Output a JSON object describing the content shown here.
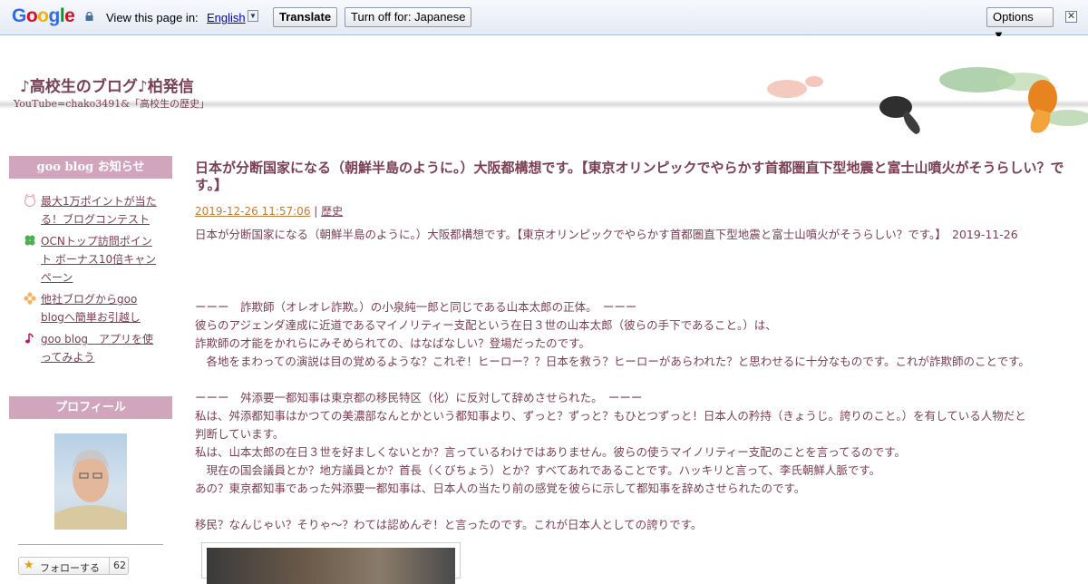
{
  "translate_bar": {
    "logo_letters": [
      "G",
      "o",
      "o",
      "g",
      "l",
      "e"
    ],
    "view_text": "View this page in:",
    "language": "English",
    "translate_button": "Translate",
    "turn_off_button": "Turn off for: Japanese",
    "options_button": "Options ▼",
    "close": "✕"
  },
  "blog": {
    "title": "♪高校生のブログ♪柏発信",
    "subtitle": "YouTube=chako3491&「高校生の歴史」"
  },
  "sidebar": {
    "notice_heading": "goo blog お知らせ",
    "notices": [
      {
        "label": "最大1万ポイントが当たる！ブログコンテスト",
        "icon": "cat-icon"
      },
      {
        "label": "OCNトップ訪問ポイント ボーナス10倍キャンペーン",
        "icon": "clover-icon"
      },
      {
        "label": "他社ブログからgoo blogへ簡単お引越し",
        "icon": "flower-icon"
      },
      {
        "label": "goo blog　アプリを使ってみよう",
        "icon": "music-note-icon"
      }
    ],
    "profile_heading": "プロフィール",
    "follow_label": "フォローする",
    "follow_count": "62"
  },
  "post": {
    "title": "日本が分断国家になる（朝鮮半島のように。）大阪都構想です。【東京オリンピックでやらかす首都圏直下型地震と富士山噴火がそうらしい？です。】",
    "date": "2019-12-26 11:57:06",
    "separator": "|",
    "category": "歴史",
    "lines": [
      "日本が分断国家になる（朝鮮半島のように。）大阪都構想です。【東京オリンピックでやらかす首都圏直下型地震と富士山噴火がそうらしい？です。】　2019-11-26",
      "",
      "",
      "",
      "ーーー　詐欺師（オレオレ詐欺。）の小泉純一郎と同じである山本太郎の正体。　ーーー",
      "彼らのアジェンダ達成に近道であるマイノリティー支配という在日３世の山本太郎（彼らの手下であること。）は、",
      "詐欺師の才能をかれらにみそめられての、はなばなしい？登場だったのです。",
      "　各地をまわっての演説は目の覚めるような？これぞ！ヒーロー？？日本を救う？ヒーローがあらわれた？と思わせるに十分なものです。これが詐欺師のことです。",
      "",
      "ーーー　舛添要一都知事は東京都の移民特区（化）に反対して辞めさせられた。　ーーー",
      "私は、舛添都知事はかつての美濃部なんとかという都知事より、ずっと？ずっと？もひとつずっと！日本人の矜持（きょうじ。誇りのこと。）を有している人物だと",
      "判断しています。",
      "私は、山本太郎の在日３世を好ましくないとか？言っているわけではありません。彼らの使うマイノリティー支配のことを言ってるのです。",
      "　現在の国会議員とか？地方議員とか？首長（くびちょう）とか？すべてあれであることです。ハッキリと言って、李氏朝鮮人脈です。",
      "あの？東京都知事であった舛添要一都知事は、日本人の当たり前の感覚を彼らに示して都知事を辞めさせられたのです。",
      "",
      "移民？なんじゃい？そりゃ〜？わては認めんぞ！と言ったのです。これが日本人としての誇りです。"
    ]
  }
}
